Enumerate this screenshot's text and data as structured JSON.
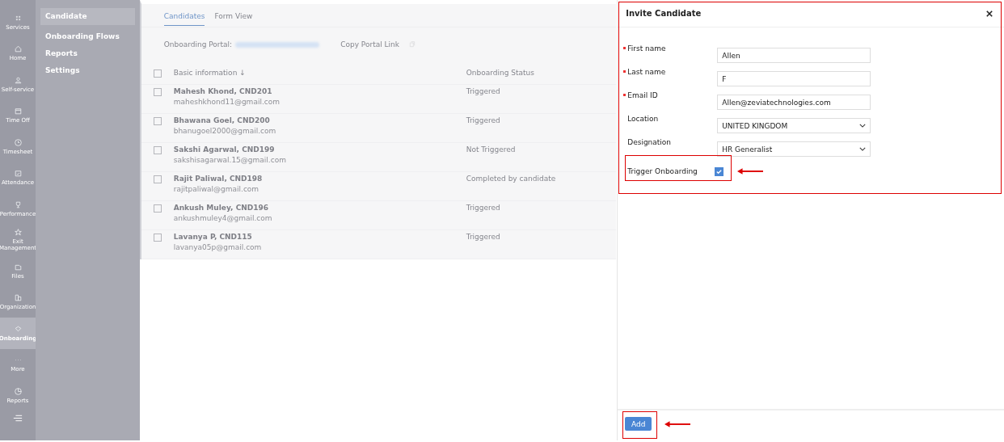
{
  "rail": [
    {
      "label": "Services",
      "selected": false
    },
    {
      "label": "Home",
      "selected": false
    },
    {
      "label": "Self-service",
      "selected": false
    },
    {
      "label": "Time Off",
      "selected": false
    },
    {
      "label": "Timesheet",
      "selected": false
    },
    {
      "label": "Attendance",
      "selected": false
    },
    {
      "label": "Performance",
      "selected": false
    },
    {
      "label": "Exit Management",
      "selected": false
    },
    {
      "label": "Files",
      "selected": false
    },
    {
      "label": "Organization",
      "selected": false
    },
    {
      "label": "Onboarding",
      "selected": true
    },
    {
      "label": "More",
      "selected": false
    },
    {
      "label": "Reports",
      "selected": false
    }
  ],
  "submenu": [
    {
      "label": "Candidate",
      "selected": true
    },
    {
      "label": "Onboarding Flows",
      "selected": false
    },
    {
      "label": "Reports",
      "selected": false
    },
    {
      "label": "Settings",
      "selected": false
    }
  ],
  "tabs": [
    {
      "label": "Candidates",
      "selected": true
    },
    {
      "label": "Form View",
      "selected": false
    }
  ],
  "portal": {
    "label": "Onboarding Portal:",
    "copy": "Copy Portal Link"
  },
  "table": {
    "select_all": {
      "checked": false
    },
    "columns": [
      "Basic information ↓",
      "Onboarding Status"
    ],
    "rows": [
      {
        "name": "Mahesh Khond, CND201",
        "email": "maheshkhond11@gmail.com",
        "status": "Triggered",
        "checked": false
      },
      {
        "name": "Bhawana Goel, CND200",
        "email": "bhanugoel2000@gmail.com",
        "status": "Triggered",
        "checked": false
      },
      {
        "name": "Sakshi Agarwal, CND199",
        "email": "sakshisagarwal.15@gmail.com",
        "status": "Not Triggered",
        "checked": false
      },
      {
        "name": "Rajit Paliwal, CND198",
        "email": "rajitpaliwal@gmail.com",
        "status": "Completed by candidate",
        "checked": false
      },
      {
        "name": "Ankush Muley, CND196",
        "email": "ankushmuley4@gmail.com",
        "status": "Triggered",
        "checked": false
      },
      {
        "name": "Lavanya P, CND115",
        "email": "lavanya05p@gmail.com",
        "status": "Triggered",
        "checked": false
      }
    ]
  },
  "dialog": {
    "title": "Invite Candidate",
    "fields": [
      {
        "kind": "text",
        "label": "First name",
        "required": true,
        "value": "Allen"
      },
      {
        "kind": "text",
        "label": "Last name",
        "required": true,
        "value": "F"
      },
      {
        "kind": "text",
        "label": "Email ID",
        "required": true,
        "value": "Allen@zeviatechnologies.com"
      },
      {
        "kind": "select",
        "label": "Location",
        "required": false,
        "value": "UNITED KINGDOM"
      },
      {
        "kind": "select",
        "label": "Designation",
        "required": false,
        "value": "HR Generalist"
      }
    ],
    "trigger": {
      "label": "Trigger Onboarding",
      "checked": true
    },
    "add": "Add"
  }
}
